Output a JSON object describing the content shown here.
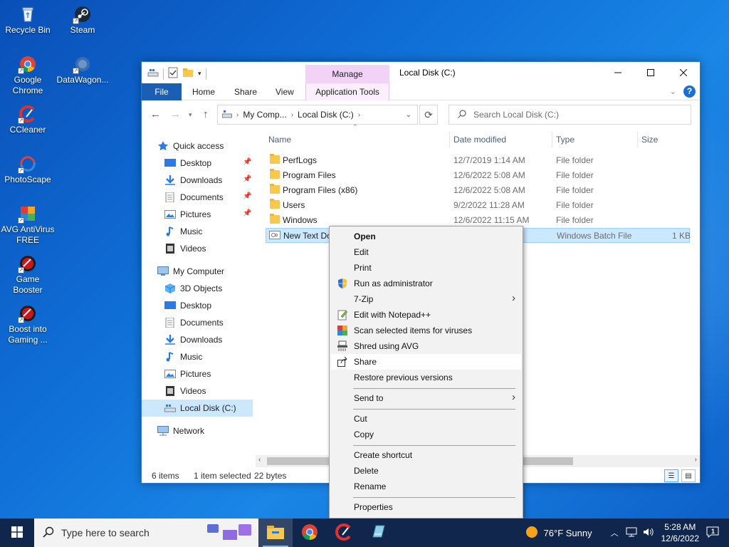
{
  "desktop": {
    "icons": [
      {
        "label": "Recycle Bin"
      },
      {
        "label": "Steam"
      },
      {
        "label": "Google Chrome"
      },
      {
        "label": "DataWagon..."
      },
      {
        "label": "CCleaner"
      },
      {
        "label": "PhotoScape"
      },
      {
        "label": "AVG AntiVirus FREE"
      },
      {
        "label": "Game Booster"
      },
      {
        "label": "Boost into Gaming ..."
      }
    ]
  },
  "explorer": {
    "title": "Local Disk (C:)",
    "contextual_header": "Manage",
    "ribbon_tabs": [
      "File",
      "Home",
      "Share",
      "View",
      "Application Tools"
    ],
    "address": {
      "crumb1": "My Comp...",
      "crumb2": "Local Disk (C:)"
    },
    "search": {
      "placeholder": "Search Local Disk (C:)"
    },
    "nav": {
      "quick_access": "Quick access",
      "quick_items": [
        "Desktop",
        "Downloads",
        "Documents",
        "Pictures",
        "Music",
        "Videos"
      ],
      "my_computer": "My Computer",
      "computer_items": [
        "3D Objects",
        "Desktop",
        "Documents",
        "Downloads",
        "Music",
        "Pictures",
        "Videos",
        "Local Disk (C:)"
      ],
      "network": "Network"
    },
    "columns": [
      "Name",
      "Date modified",
      "Type",
      "Size"
    ],
    "files": [
      {
        "name": "PerfLogs",
        "date": "12/7/2019 1:14 AM",
        "type": "File folder",
        "size": ""
      },
      {
        "name": "Program Files",
        "date": "12/6/2022 5:08 AM",
        "type": "File folder",
        "size": ""
      },
      {
        "name": "Program Files (x86)",
        "date": "12/6/2022 5:08 AM",
        "type": "File folder",
        "size": ""
      },
      {
        "name": "Users",
        "date": "9/2/2022 11:28 AM",
        "type": "File folder",
        "size": ""
      },
      {
        "name": "Windows",
        "date": "12/6/2022 11:15 AM",
        "type": "File folder",
        "size": ""
      },
      {
        "name": "New Text Do",
        "date": "",
        "type": "Windows Batch File",
        "size": "1 KB"
      }
    ],
    "status": {
      "items": "6 items",
      "selected": "1 item selected",
      "size": "22 bytes"
    }
  },
  "context_menu": {
    "items": [
      "Open",
      "Edit",
      "Print",
      "Run as administrator",
      "7-Zip",
      "Edit with Notepad++",
      "Scan selected items for viruses",
      "Shred using AVG",
      "Share",
      "Restore previous versions",
      "Send to",
      "Cut",
      "Copy",
      "Create shortcut",
      "Delete",
      "Rename",
      "Properties"
    ],
    "highlighted": "Share"
  },
  "taskbar": {
    "search_placeholder": "Type here to search",
    "weather": "76°F  Sunny",
    "time": "5:28 AM",
    "date": "12/6/2022",
    "notifications": "1"
  },
  "colors": {
    "accent": "#1a5fb4",
    "selection": "#cce8ff",
    "taskbar": "#10264d"
  }
}
